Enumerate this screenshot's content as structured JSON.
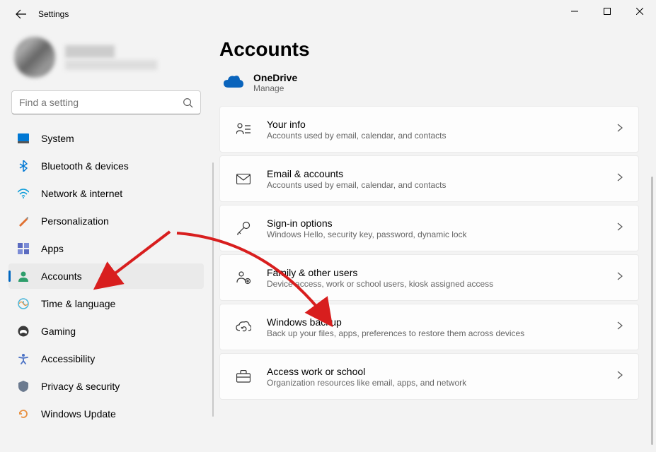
{
  "window": {
    "title": "Settings"
  },
  "profile": {
    "name": "████████",
    "email": "████████@██████.███"
  },
  "search": {
    "placeholder": "Find a setting"
  },
  "nav": {
    "items": [
      {
        "label": "System"
      },
      {
        "label": "Bluetooth & devices"
      },
      {
        "label": "Network & internet"
      },
      {
        "label": "Personalization"
      },
      {
        "label": "Apps"
      },
      {
        "label": "Accounts"
      },
      {
        "label": "Time & language"
      },
      {
        "label": "Gaming"
      },
      {
        "label": "Accessibility"
      },
      {
        "label": "Privacy & security"
      },
      {
        "label": "Windows Update"
      }
    ],
    "active_index": 5
  },
  "page": {
    "title": "Accounts",
    "onedrive": {
      "title": "OneDrive",
      "subtitle": "Manage"
    },
    "cards": [
      {
        "title": "Your info",
        "subtitle": "Accounts used by email, calendar, and contacts"
      },
      {
        "title": "Email & accounts",
        "subtitle": "Accounts used by email, calendar, and contacts"
      },
      {
        "title": "Sign-in options",
        "subtitle": "Windows Hello, security key, password, dynamic lock"
      },
      {
        "title": "Family & other users",
        "subtitle": "Device access, work or school users, kiosk assigned access"
      },
      {
        "title": "Windows backup",
        "subtitle": "Back up your files, apps, preferences to restore them across devices"
      },
      {
        "title": "Access work or school",
        "subtitle": "Organization resources like email, apps, and network"
      }
    ]
  }
}
